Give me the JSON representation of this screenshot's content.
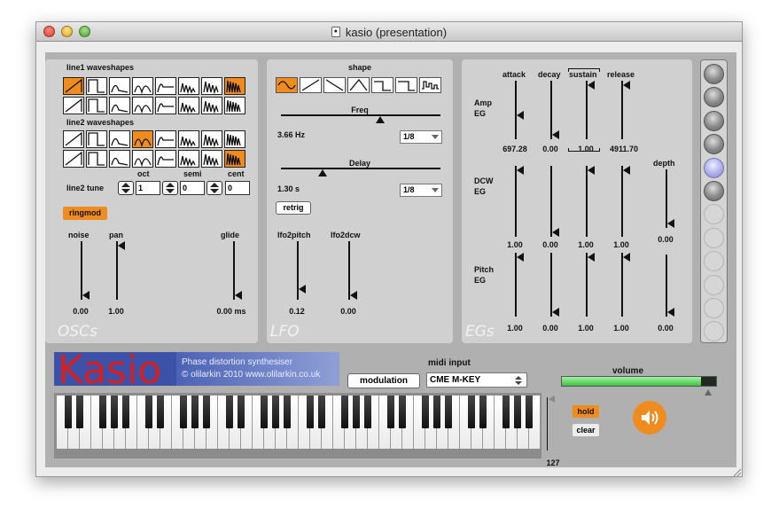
{
  "window": {
    "title": "kasio (presentation)"
  },
  "oscs": {
    "section": "OSCs",
    "line1_title": "line1 waveshapes",
    "line2_title": "line2 waveshapes",
    "line1_selected": [
      0,
      7
    ],
    "line2_selected": [
      3,
      15
    ],
    "tune_label": "line2 tune",
    "oct": {
      "label": "oct",
      "value": "1"
    },
    "semi": {
      "label": "semi",
      "value": "0"
    },
    "cent": {
      "label": "cent",
      "value": "0"
    },
    "ringmod": "ringmod",
    "noise": {
      "label": "noise",
      "value": "0.00",
      "level": 0.0
    },
    "pan": {
      "label": "pan",
      "value": "1.00",
      "level": 1.0
    },
    "glide": {
      "label": "glide",
      "value": "0.00 ms",
      "level": 0.0
    }
  },
  "lfo": {
    "section": "LFO",
    "shape_label": "shape",
    "shape_selected": 0,
    "freq": {
      "label": "Freq",
      "value": "3.66 Hz",
      "sync": "1/8",
      "level": 0.62
    },
    "delay": {
      "label": "Delay",
      "value": "1.30 s",
      "sync": "1/8",
      "level": 0.26
    },
    "retrig": "retrig",
    "lfo2pitch": {
      "label": "lfo2pitch",
      "value": "0.12",
      "level": 0.12
    },
    "lfo2dcw": {
      "label": "lfo2dcw",
      "value": "0.00",
      "level": 0.0
    }
  },
  "egs": {
    "section": "EGs",
    "headers": {
      "attack": "attack",
      "decay": "decay",
      "sustain": "sustain",
      "release": "release",
      "depth": "depth"
    },
    "amp": {
      "label1": "Amp",
      "label2": "EG",
      "values": [
        "697.28",
        "0.00",
        "1.00",
        "4911.70"
      ],
      "levels": [
        0.4,
        0.0,
        1.0,
        1.0
      ]
    },
    "dcw": {
      "label1": "DCW",
      "label2": "EG",
      "values": [
        "1.00",
        "0.00",
        "1.00",
        "1.00"
      ],
      "levels": [
        1.0,
        0.0,
        1.0,
        1.0
      ],
      "depth": "0.00",
      "depth_level": 0.0
    },
    "pitch": {
      "label1": "Pitch",
      "label2": "EG",
      "values": [
        "1.00",
        "0.00",
        "1.00",
        "1.00"
      ],
      "levels": [
        1.0,
        0.0,
        1.0,
        1.0
      ],
      "depth": "0.00",
      "depth_level": 0.0
    }
  },
  "presets": [
    "dark",
    "dark",
    "dark",
    "dark",
    "selected",
    "dark",
    "empty",
    "empty",
    "empty",
    "empty",
    "empty",
    "empty"
  ],
  "logo": {
    "name": "Kasio",
    "tagline": "Phase distortion synthesiser",
    "credit": "© olilarkin 2010 www.olilarkin.co.uk"
  },
  "modulation": "modulation",
  "midi": {
    "label": "midi input",
    "device": "CME M-KEY"
  },
  "volume": {
    "label": "volume",
    "level": 0.9
  },
  "velocity": {
    "value": "127"
  },
  "hold": "hold",
  "clear": "clear",
  "colors": {
    "accent": "#f08c1e",
    "meter": "#5de05d"
  }
}
